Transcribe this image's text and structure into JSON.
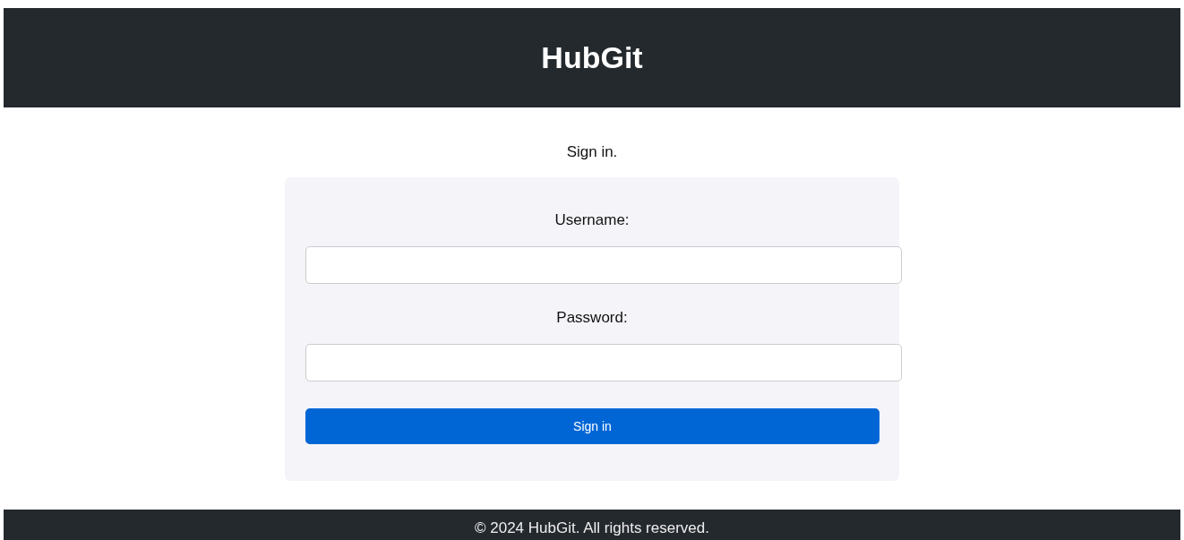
{
  "header": {
    "title": "HubGit"
  },
  "intro": "Sign in.",
  "form": {
    "fields": [
      {
        "label": "Username:"
      },
      {
        "label": "Password:"
      }
    ],
    "button": "Sign in"
  },
  "footer": "© 2024 HubGit. All rights reserved."
}
